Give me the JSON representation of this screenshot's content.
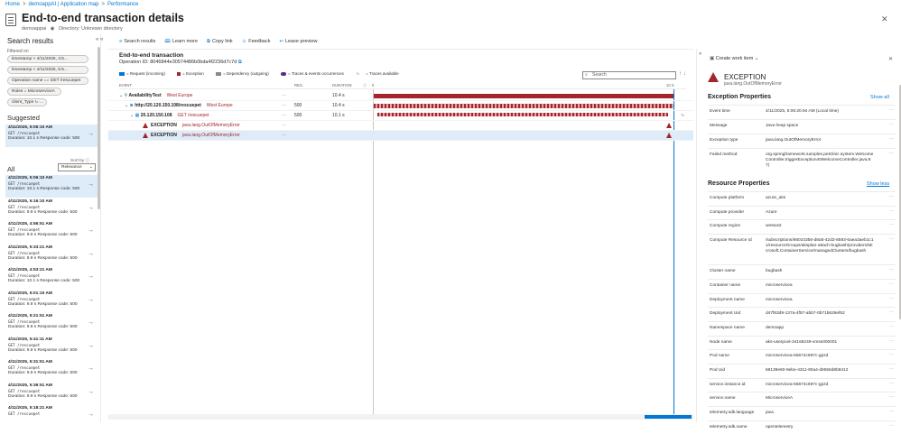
{
  "breadcrumb": [
    "Home",
    "demoappAI | Application map",
    "Performance"
  ],
  "header": {
    "title": "End-to-end transaction details",
    "pin_icon": "pin-icon",
    "more": "···",
    "resource": "demoappai",
    "directory": "Directory: Unknown directory",
    "close": "✕"
  },
  "left": {
    "title": "Search results",
    "collapse": "«  «",
    "filtered_on": "Filtered on",
    "chips": [
      "timestamp > 4/11/2025, 4:5...",
      "timestamp < 4/11/2025, 5:5...",
      "Operation name == GET /rescuepet",
      "Roles = MicroserviceA",
      "client_Type != ..."
    ],
    "suggested_label": "Suggested",
    "all_label": "All",
    "sort_label": "Sort by ⓘ",
    "sort_value": "Relevance",
    "suggested": [
      {
        "date": "4/11/2025, 5:06:10 AM",
        "method": "GET /rescuepet",
        "meta": "Duration: 10.1 s  Response code: 500"
      }
    ],
    "results": [
      {
        "date": "4/11/2025, 5:06:10 AM",
        "method": "GET /rescuepet",
        "meta": "Duration: 10.1 s  Response code: 500"
      },
      {
        "date": "4/11/2025, 5:16:10 AM",
        "method": "GET /rescuepet",
        "meta": "Duration: 9.9 s  Response code: 500"
      },
      {
        "date": "4/11/2025, 4:56:51 AM",
        "method": "GET /rescuepet",
        "meta": "Duration: 9.9 s  Response code: 500"
      },
      {
        "date": "4/11/2025, 5:33:21 AM",
        "method": "GET /rescuepet",
        "meta": "Duration: 9.9 s  Response code: 500"
      },
      {
        "date": "4/11/2025, 4:53:21 AM",
        "method": "GET /rescuepet",
        "meta": "Duration: 10.1 s  Response code: 500"
      },
      {
        "date": "4/11/2025, 5:01:10 AM",
        "method": "GET /rescuepet",
        "meta": "Duration: 9.9 s  Response code: 500"
      },
      {
        "date": "4/11/2025, 5:21:51 AM",
        "method": "GET /rescuepet",
        "meta": "Duration: 9.9 s  Response code: 500"
      },
      {
        "date": "4/11/2025, 5:41:11 AM",
        "method": "GET /rescuepet",
        "meta": "Duration: 9.9 s  Response code: 500"
      },
      {
        "date": "4/11/2025, 5:31:51 AM",
        "method": "GET /rescuepet",
        "meta": "Duration: 9.9 s  Response code: 500"
      },
      {
        "date": "4/11/2025, 5:36:51 AM",
        "method": "GET /rescuepet",
        "meta": "Duration: 9.9 s  Response code: 500"
      },
      {
        "date": "4/11/2025, 5:18:21 AM",
        "method": "GET /rescuepet",
        "meta": ""
      }
    ]
  },
  "toolbar": [
    {
      "icon": "≡",
      "label": "Search results"
    },
    {
      "icon": "🕮",
      "label": "Learn more"
    },
    {
      "icon": "⧉",
      "label": "Copy link"
    },
    {
      "icon": "☺",
      "label": "Feedback"
    },
    {
      "icon": "↩",
      "label": "Leave preview"
    }
  ],
  "center": {
    "title": "End-to-end transaction",
    "operation_id": "Operation ID: 8046844e30574486b0bda4f2236d7c7d",
    "legend": [
      "= Request (incoming)",
      "= Exception",
      "= Dependency (outgoing)",
      "= Traces & events occurrences",
      "= Traces available"
    ],
    "search_placeholder": "Search",
    "col_event": "EVENT",
    "col_res": "RES.",
    "col_duration": "DURATION",
    "col_zero": "0",
    "col_ten": "10 S",
    "rows": [
      {
        "name": "AvailabilityTest",
        "sub": "West Europe",
        "res": "",
        "dur": "10.4 s"
      },
      {
        "name": "http://20.120.150.108/rescuepet",
        "sub": "West Europe",
        "res": "500",
        "dur": "10.4 s"
      },
      {
        "name": "20.120.150.108",
        "sub": "GET /rescuepet",
        "res": "500",
        "dur": "10.1 s"
      },
      {
        "name": "EXCEPTION",
        "sub": "java.lang.OutOfMemoryError",
        "res": "",
        "dur": ""
      },
      {
        "name": "EXCEPTION",
        "sub": "java.lang.OutOfMemoryError",
        "res": "",
        "dur": ""
      }
    ]
  },
  "right": {
    "create_work_item": "Create work item",
    "exception_title": "EXCEPTION",
    "exception_sub": "java.lang.OutOfMemoryError",
    "exc_props_title": "Exception Properties",
    "show_all": "Show all",
    "exc_props": [
      {
        "k": "Event time",
        "v": "4/11/2025, 5:06:20.94 AM (Local time)"
      },
      {
        "k": "Message",
        "v": "Java heap space"
      },
      {
        "k": "Exception type",
        "v": "java.lang.OutOfMemoryError"
      },
      {
        "k": "Failed method",
        "v": "org.springframework.samples.petclinic.system.WelcomeController.triggerException40WelcomeController.java:87)"
      }
    ],
    "res_props_title": "Resource Properties",
    "show_less": "Show less",
    "res_props": [
      {
        "k": "Compute platform",
        "v": "azure_aks"
      },
      {
        "k": "Compute provider",
        "v": "Azure"
      },
      {
        "k": "Compute region",
        "v": "westus2"
      },
      {
        "k": "Compute Resource Id",
        "v": "/subscriptions/66010356-d8a5-42d3-8593-6aea3aeb1c11/resourceGroups/aksplan-attach-bugbash/providers/Microsoft.ContainerService/managedClusters/bugbash"
      },
      {
        "k": "Cluster name",
        "v": "bugbash"
      },
      {
        "k": "Container name",
        "v": "microservicea"
      },
      {
        "k": "Deployment name",
        "v": "microservicea"
      },
      {
        "k": "Deployment Uid",
        "v": "d47f63d9-137a-4f57-abb7-0b71b626ef62"
      },
      {
        "k": "Namespace name",
        "v": "demoapp"
      },
      {
        "k": "Node name",
        "v": "aks-userpool-34166249-vmss000001"
      },
      {
        "k": "Pod name",
        "v": "microservicea-56674c697c-gpzd"
      },
      {
        "k": "Pod Uid",
        "v": "68139e60-9ebe-4311-90a4-d6556d8b8412"
      },
      {
        "k": "service.instance.id",
        "v": "microservicea-56674c697c-gpzd"
      },
      {
        "k": "service.name",
        "v": "MicroserviceA"
      },
      {
        "k": "telemetry.sdk.language",
        "v": "java"
      },
      {
        "k": "telemetry.sdk.name",
        "v": "opentelemetry"
      }
    ]
  },
  "colors": {
    "accent": "#0078d4",
    "error": "#a4262c"
  }
}
